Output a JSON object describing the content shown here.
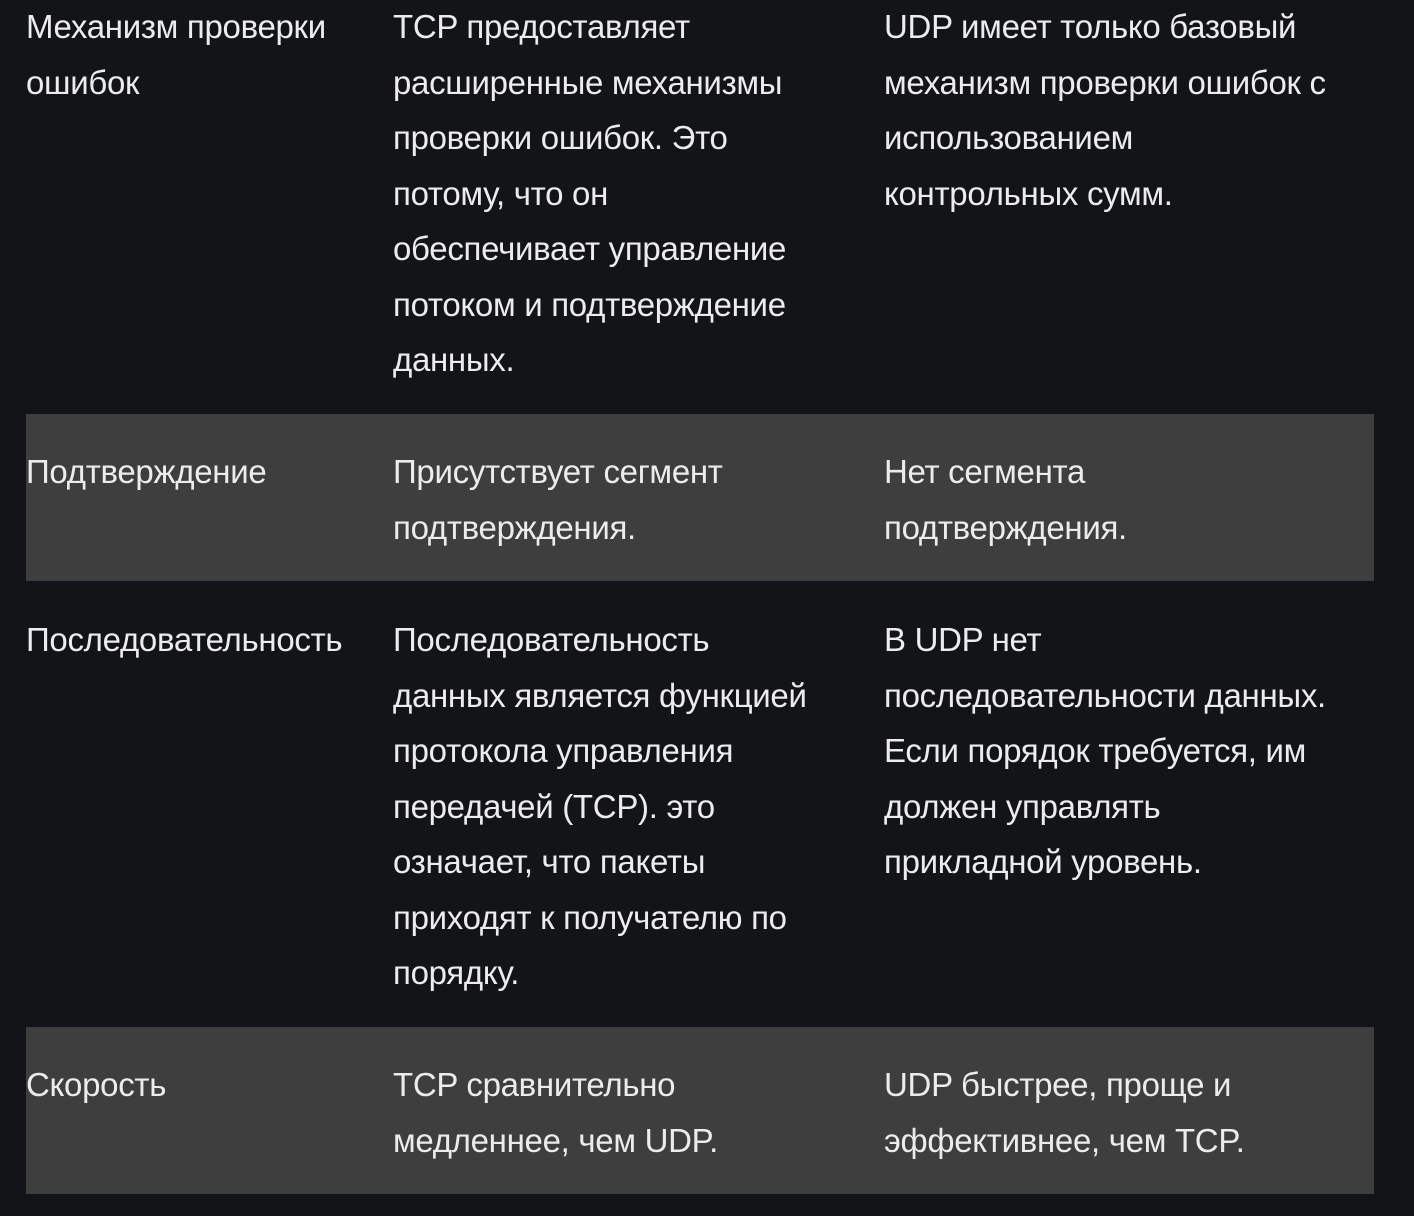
{
  "rows": [
    {
      "feature": [
        "Механизм проверки",
        "ошибок"
      ],
      "tcp": [
        "TCP предоставляет",
        "расширенные механизмы",
        "проверки ошибок. Это",
        "потому, что он",
        "обеспечивает управление",
        "потоком и подтверждение",
        "данных."
      ],
      "udp": [
        "UDP имеет только базовый",
        "механизм проверки ошибок с",
        "использованием",
        "контрольных сумм."
      ]
    },
    {
      "feature": [
        "Подтверждение"
      ],
      "tcp": [
        "Присутствует сегмент",
        "подтверждения."
      ],
      "udp": [
        "Нет сегмента",
        "подтверждения."
      ]
    },
    {
      "feature": [
        "Последовательность"
      ],
      "tcp": [
        "Последовательность",
        "данных является функцией",
        "протокола управления",
        "передачей (TCP). это",
        "означает, что пакеты",
        "приходят к получателю по",
        "порядку."
      ],
      "udp": [
        "В UDP нет",
        "последовательности данных.",
        "Если порядок требуется, им",
        "должен управлять",
        "прикладной уровень."
      ]
    },
    {
      "feature": [
        "Скорость"
      ],
      "tcp": [
        "TCP сравнительно",
        "медленнее, чем UDP."
      ],
      "udp": [
        "UDP быстрее, проще и",
        "эффективнее, чем TCP."
      ]
    }
  ],
  "colors": {
    "background": "#131418",
    "shaded_row": "#3e3e3e",
    "text": "#ececec"
  }
}
